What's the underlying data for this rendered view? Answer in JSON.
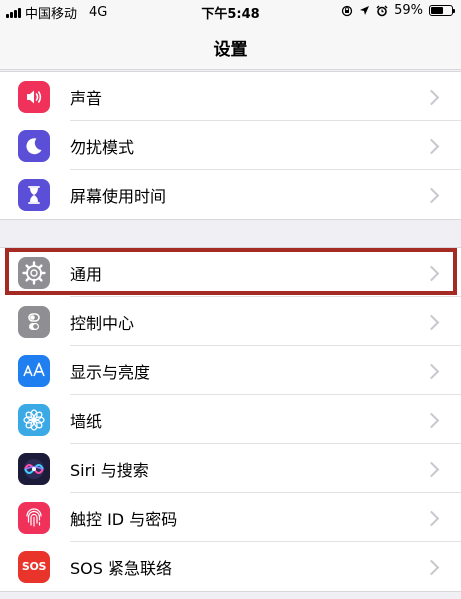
{
  "status_bar": {
    "carrier": "中国移动",
    "network": "4G",
    "time": "下午5:48",
    "battery_percent": "59%",
    "battery_level": 0.59,
    "icons": [
      "lock-rotation-icon",
      "location-icon",
      "alarm-icon",
      "battery-icon"
    ]
  },
  "nav": {
    "title": "设置"
  },
  "group1": [
    {
      "label": "声音",
      "icon": "speaker-icon",
      "color": "#f0325a"
    },
    {
      "label": "勿扰模式",
      "icon": "moon-icon",
      "color": "#5b4fd8"
    },
    {
      "label": "屏幕使用时间",
      "icon": "hourglass-icon",
      "color": "#5b4fd8"
    }
  ],
  "group2": [
    {
      "label": "通用",
      "icon": "gear-icon",
      "color": "#8e8e93"
    },
    {
      "label": "控制中心",
      "icon": "toggles-icon",
      "color": "#8e8e93"
    },
    {
      "label": "显示与亮度",
      "icon": "display-aa-icon",
      "color": "#1f7ef0"
    },
    {
      "label": "墙纸",
      "icon": "flower-icon",
      "color": "#3aa9e6"
    },
    {
      "label": "Siri 与搜索",
      "icon": "siri-icon",
      "color": "#1c1c3a"
    },
    {
      "label": "触控 ID 与密码",
      "icon": "fingerprint-icon",
      "color": "#f0325a"
    },
    {
      "label": "SOS 紧急联络",
      "icon": "sos-icon",
      "color": "#e8342b",
      "icon_text": "SOS"
    }
  ],
  "highlight": {
    "target": "通用",
    "color": "#a52a23"
  }
}
